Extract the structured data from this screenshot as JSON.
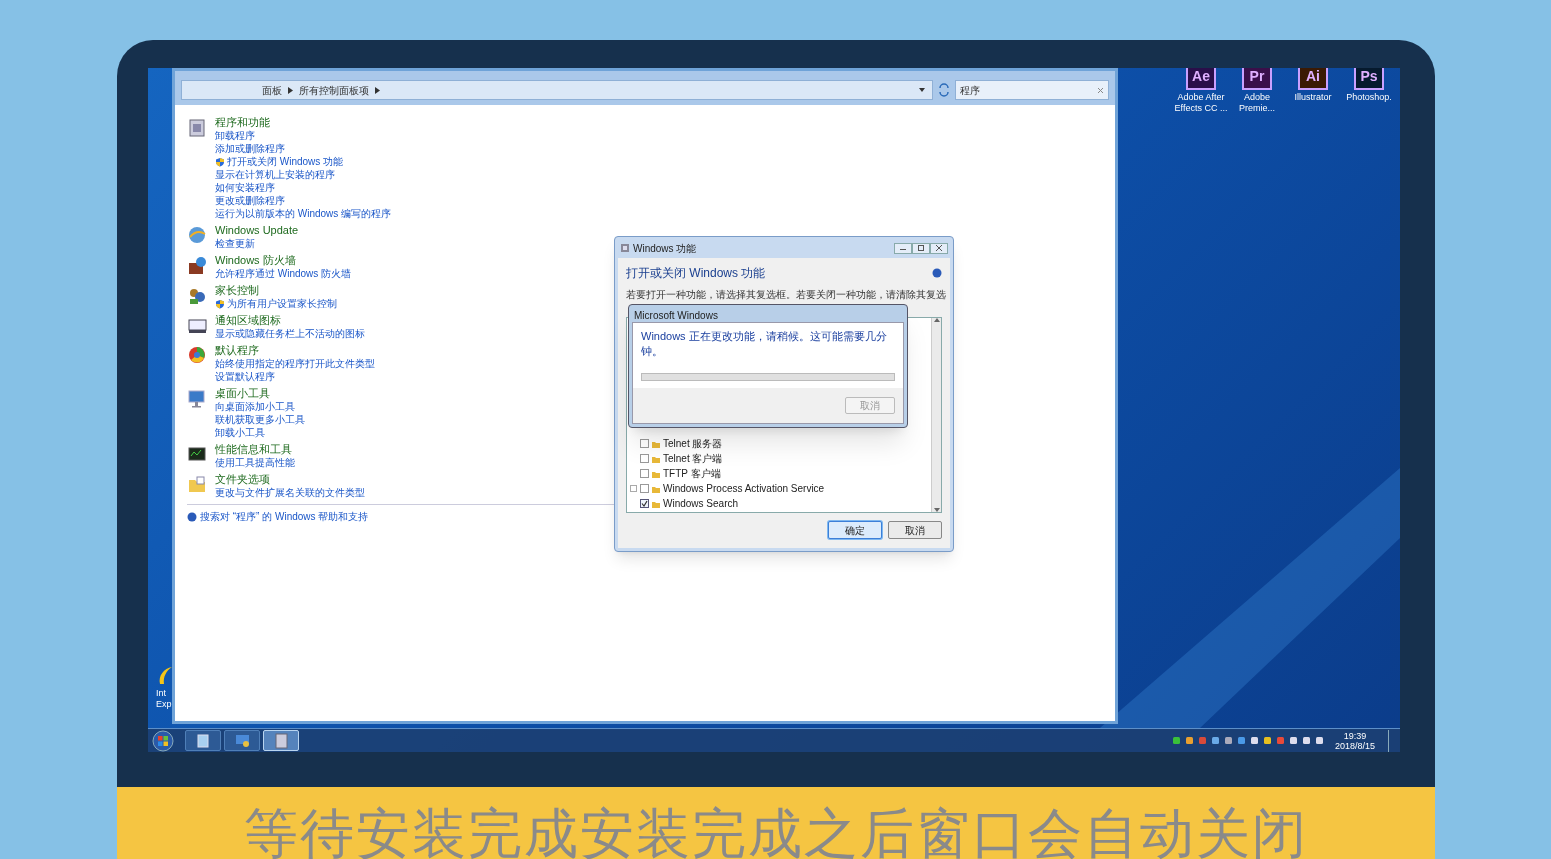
{
  "explorer": {
    "breadcrumb": [
      "面板",
      "所有控制面板项"
    ],
    "search": {
      "value": "程序"
    },
    "categories": [
      {
        "title": "程序和功能",
        "links": [
          {
            "text": "卸载程序",
            "shield": false
          },
          {
            "text": "添加或删除程序",
            "shield": false
          },
          {
            "text": "打开或关闭 Windows 功能",
            "shield": true
          },
          {
            "text": "显示在计算机上安装的程序",
            "shield": false
          },
          {
            "text": "如何安装程序",
            "shield": false
          },
          {
            "text": "更改或删除程序",
            "shield": false
          },
          {
            "text": "运行为以前版本的 Windows 编写的程序",
            "shield": false
          }
        ]
      },
      {
        "title": "Windows Update",
        "links": [
          {
            "text": "检查更新",
            "shield": false
          }
        ]
      },
      {
        "title": "Windows 防火墙",
        "links": [
          {
            "text": "允许程序通过 Windows 防火墙",
            "shield": false
          }
        ]
      },
      {
        "title": "家长控制",
        "links": [
          {
            "text": "为所有用户设置家长控制",
            "shield": true
          }
        ]
      },
      {
        "title": "通知区域图标",
        "links": [
          {
            "text": "显示或隐藏任务栏上不活动的图标",
            "shield": false
          }
        ]
      },
      {
        "title": "默认程序",
        "links": [
          {
            "text": "始终使用指定的程序打开此文件类型",
            "shield": false
          },
          {
            "text": "设置默认程序",
            "shield": false
          }
        ]
      },
      {
        "title": "桌面小工具",
        "links": [
          {
            "text": "向桌面添加小工具",
            "shield": false
          },
          {
            "text": "联机获取更多小工具",
            "shield": false
          },
          {
            "text": "卸载小工具",
            "shield": false
          }
        ]
      },
      {
        "title": "性能信息和工具",
        "links": [
          {
            "text": "使用工具提高性能",
            "shield": false
          }
        ]
      },
      {
        "title": "文件夹选项",
        "links": [
          {
            "text": "更改与文件扩展名关联的文件类型",
            "shield": false
          }
        ]
      }
    ],
    "help_link": "搜索对 “程序” 的 Windows 帮助和支持"
  },
  "features_dialog": {
    "title": "Windows 功能",
    "heading": "打开或关闭 Windows 功能",
    "description": "若要打开一种功能，请选择其复选框。若要关闭一种功能，请清除其复选",
    "features": [
      {
        "label": "Telnet 服务器",
        "checked": false,
        "expandable": false
      },
      {
        "label": "Telnet 客户端",
        "checked": false,
        "expandable": false
      },
      {
        "label": "TFTP 客户端",
        "checked": false,
        "expandable": false
      },
      {
        "label": "Windows Process Activation Service",
        "checked": false,
        "expandable": true
      },
      {
        "label": "Windows Search",
        "checked": true,
        "expandable": false
      }
    ],
    "buttons": [
      {
        "label": "确定",
        "focused": true
      },
      {
        "label": "取消",
        "focused": false
      }
    ]
  },
  "progress_dialog": {
    "title": "Microsoft Windows",
    "message": "Windows 正在更改功能，请稍候。这可能需要几分钟。",
    "progress": {
      "level": 0
    },
    "cancel": {
      "label": "取消",
      "disabled": true
    }
  },
  "desktop_icons": [
    {
      "badge": "Ae",
      "label": "Adobe After Effects CC ...",
      "color": "#2a0f4a"
    },
    {
      "badge": "Pr",
      "label": "Adobe Premie...",
      "color": "#3a0f4a"
    },
    {
      "badge": "Ai",
      "label": "Illustrator",
      "color": "#3a1a04"
    },
    {
      "badge": "Ps",
      "label": "Photoshop.",
      "color": "#061a2e"
    }
  ],
  "desktop_icon_left": {
    "label_lines": [
      "Int",
      "Exp"
    ]
  },
  "taskbar": {
    "buttons": [
      {
        "selected": false
      },
      {
        "selected": false
      },
      {
        "selected": true
      }
    ],
    "time": "19:39",
    "date": "2018/8/15"
  },
  "subtitle": "等待安装完成安装完成之后窗口会自动关闭"
}
